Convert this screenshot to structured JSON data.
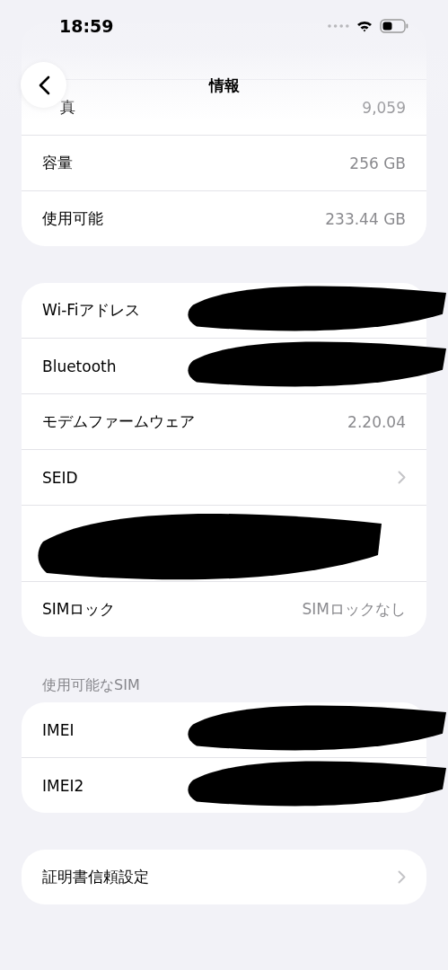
{
  "status_bar": {
    "time": "18:59"
  },
  "nav": {
    "title": "情報"
  },
  "groups": [
    {
      "rows": [
        {
          "label": "真",
          "value": "9,059"
        },
        {
          "label": "容量",
          "value": "256 GB"
        },
        {
          "label": "使用可能",
          "value": "233.44 GB"
        }
      ]
    },
    {
      "rows": [
        {
          "label": "Wi-Fiアドレス",
          "redacted": true
        },
        {
          "label": "Bluetooth",
          "redacted": true
        },
        {
          "label": "モデムファームウェア",
          "value": "2.20.04"
        },
        {
          "label": "SEID",
          "chevron": true
        },
        {
          "redacted": true
        },
        {
          "label": "SIMロック",
          "value": "SIMロックなし"
        }
      ]
    },
    {
      "header": "使用可能なSIM",
      "rows": [
        {
          "label": "IMEI",
          "redacted": true
        },
        {
          "label": "IMEI2",
          "redacted": true
        }
      ]
    },
    {
      "rows": [
        {
          "label": "証明書信頼設定",
          "chevron": true
        }
      ]
    }
  ]
}
